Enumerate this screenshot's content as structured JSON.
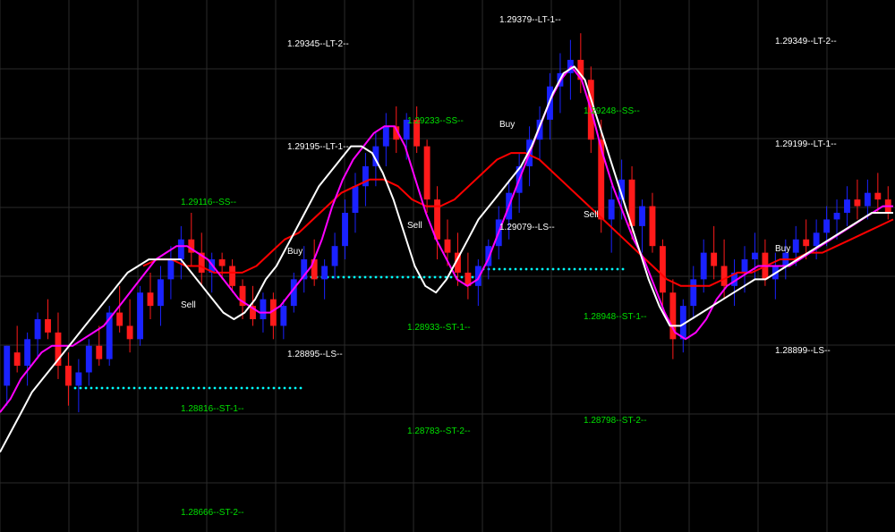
{
  "colors": {
    "background": "#000000",
    "grid": "#2a2a2a",
    "bull": "#1a22ff",
    "bear": "#ff1a1a",
    "doji": "#ffffff",
    "ma_fast": "#ff00ff",
    "ma_slow": "#ffffff",
    "ma_mid": "#ff0000",
    "level_long": "#ffffff",
    "level_short": "#00e000",
    "dots": "#00ffff"
  },
  "chart_data": {
    "type": "candlestick",
    "y_range": [
      1.2862,
      1.2942
    ],
    "grid": true,
    "candles": [
      [
        1.2884,
        1.289,
        1.2881,
        1.289
      ],
      [
        1.2889,
        1.2893,
        1.2886,
        1.2887
      ],
      [
        1.2887,
        1.2892,
        1.2884,
        1.2891
      ],
      [
        1.2891,
        1.2895,
        1.2888,
        1.2894
      ],
      [
        1.2894,
        1.2897,
        1.2891,
        1.2892
      ],
      [
        1.2892,
        1.2895,
        1.2885,
        1.2887
      ],
      [
        1.2887,
        1.2889,
        1.2881,
        1.2884
      ],
      [
        1.2884,
        1.2888,
        1.288,
        1.2886
      ],
      [
        1.2886,
        1.2891,
        1.2884,
        1.289
      ],
      [
        1.289,
        1.2893,
        1.2887,
        1.2888
      ],
      [
        1.2888,
        1.2896,
        1.2887,
        1.2895
      ],
      [
        1.2895,
        1.2899,
        1.2892,
        1.2893
      ],
      [
        1.2893,
        1.2897,
        1.2889,
        1.2891
      ],
      [
        1.2891,
        1.2899,
        1.289,
        1.2898
      ],
      [
        1.2898,
        1.2901,
        1.2894,
        1.2896
      ],
      [
        1.2896,
        1.2902,
        1.2893,
        1.29
      ],
      [
        1.29,
        1.2905,
        1.2897,
        1.2903
      ],
      [
        1.2903,
        1.2908,
        1.29,
        1.2906
      ],
      [
        1.2906,
        1.291,
        1.2902,
        1.2904
      ],
      [
        1.2904,
        1.2907,
        1.2899,
        1.2901
      ],
      [
        1.2901,
        1.2904,
        1.2898,
        1.2903
      ],
      [
        1.2903,
        1.2904,
        1.29,
        1.2902
      ],
      [
        1.2902,
        1.2903,
        1.2898,
        1.2899
      ],
      [
        1.2899,
        1.29,
        1.2894,
        1.2896
      ],
      [
        1.2896,
        1.2899,
        1.2893,
        1.2894
      ],
      [
        1.2894,
        1.2898,
        1.2892,
        1.2897
      ],
      [
        1.2897,
        1.2898,
        1.2891,
        1.2893
      ],
      [
        1.2893,
        1.2897,
        1.2891,
        1.2896
      ],
      [
        1.2896,
        1.2901,
        1.2895,
        1.29
      ],
      [
        1.29,
        1.2905,
        1.2898,
        1.2903
      ],
      [
        1.2903,
        1.2906,
        1.2899,
        1.29
      ],
      [
        1.29,
        1.2903,
        1.2897,
        1.2902
      ],
      [
        1.2902,
        1.2907,
        1.29,
        1.2905
      ],
      [
        1.2905,
        1.2912,
        1.2903,
        1.291
      ],
      [
        1.291,
        1.2916,
        1.2907,
        1.2914
      ],
      [
        1.2914,
        1.2919,
        1.2911,
        1.2917
      ],
      [
        1.2917,
        1.2922,
        1.2914,
        1.292
      ],
      [
        1.292,
        1.2925,
        1.2917,
        1.2923
      ],
      [
        1.2923,
        1.2926,
        1.2919,
        1.2921
      ],
      [
        1.2921,
        1.2925,
        1.2918,
        1.2924
      ],
      [
        1.2924,
        1.2926,
        1.2919,
        1.292
      ],
      [
        1.292,
        1.2921,
        1.291,
        1.2912
      ],
      [
        1.2912,
        1.2914,
        1.2903,
        1.2906
      ],
      [
        1.2906,
        1.2909,
        1.2902,
        1.2904
      ],
      [
        1.2904,
        1.2907,
        1.2899,
        1.2901
      ],
      [
        1.2901,
        1.2904,
        1.2897,
        1.2899
      ],
      [
        1.2899,
        1.2903,
        1.2896,
        1.2902
      ],
      [
        1.2902,
        1.2906,
        1.29,
        1.2905
      ],
      [
        1.2905,
        1.2911,
        1.2903,
        1.2909
      ],
      [
        1.2909,
        1.2915,
        1.2906,
        1.2913
      ],
      [
        1.2913,
        1.2919,
        1.291,
        1.2917
      ],
      [
        1.2917,
        1.2923,
        1.2914,
        1.2921
      ],
      [
        1.2921,
        1.2926,
        1.2918,
        1.2924
      ],
      [
        1.2924,
        1.2931,
        1.2921,
        1.2929
      ],
      [
        1.2929,
        1.2934,
        1.2925,
        1.2931
      ],
      [
        1.2931,
        1.2936,
        1.2927,
        1.2933
      ],
      [
        1.2933,
        1.2937,
        1.2928,
        1.293
      ],
      [
        1.293,
        1.2932,
        1.2919,
        1.2921
      ],
      [
        1.2921,
        1.2924,
        1.2907,
        1.2909
      ],
      [
        1.2909,
        1.2914,
        1.2904,
        1.2912
      ],
      [
        1.2912,
        1.2918,
        1.2909,
        1.2915
      ],
      [
        1.2915,
        1.2917,
        1.2906,
        1.2908
      ],
      [
        1.2908,
        1.2912,
        1.2904,
        1.2911
      ],
      [
        1.2911,
        1.2913,
        1.2904,
        1.2905
      ],
      [
        1.2905,
        1.2906,
        1.2896,
        1.2898
      ],
      [
        1.2898,
        1.29,
        1.2888,
        1.2891
      ],
      [
        1.2891,
        1.2897,
        1.2889,
        1.2896
      ],
      [
        1.2896,
        1.2902,
        1.2894,
        1.29
      ],
      [
        1.29,
        1.2906,
        1.2898,
        1.2904
      ],
      [
        1.2904,
        1.2908,
        1.29,
        1.2902
      ],
      [
        1.2902,
        1.2906,
        1.2897,
        1.2899
      ],
      [
        1.2899,
        1.2903,
        1.2896,
        1.2901
      ],
      [
        1.2901,
        1.2905,
        1.2898,
        1.2903
      ],
      [
        1.2903,
        1.2907,
        1.29,
        1.2904
      ],
      [
        1.2904,
        1.2906,
        1.2899,
        1.29
      ],
      [
        1.29,
        1.2904,
        1.2897,
        1.2902
      ],
      [
        1.2902,
        1.2906,
        1.29,
        1.2904
      ],
      [
        1.2904,
        1.2908,
        1.2902,
        1.2906
      ],
      [
        1.2906,
        1.2909,
        1.2903,
        1.2905
      ],
      [
        1.2905,
        1.2909,
        1.2903,
        1.2907
      ],
      [
        1.2907,
        1.2911,
        1.2905,
        1.2909
      ],
      [
        1.2909,
        1.2912,
        1.2906,
        1.291
      ],
      [
        1.291,
        1.2914,
        1.2908,
        1.2912
      ],
      [
        1.2912,
        1.2915,
        1.2909,
        1.2911
      ],
      [
        1.2911,
        1.2915,
        1.2909,
        1.2913
      ],
      [
        1.2913,
        1.2916,
        1.291,
        1.2912
      ],
      [
        1.2912,
        1.2914,
        1.2909,
        1.291
      ]
    ],
    "ma_fast": [
      1.288,
      1.2882,
      1.2885,
      1.2887,
      1.2889,
      1.289,
      1.289,
      1.289,
      1.2891,
      1.2892,
      1.2893,
      1.2895,
      1.2897,
      1.2899,
      1.2901,
      1.2903,
      1.2904,
      1.2905,
      1.2905,
      1.2904,
      1.2903,
      1.2901,
      1.2899,
      1.2897,
      1.2896,
      1.2895,
      1.2895,
      1.2896,
      1.2898,
      1.29,
      1.2902,
      1.2906,
      1.2911,
      1.2915,
      1.2918,
      1.292,
      1.2922,
      1.2923,
      1.2923,
      1.292,
      1.2915,
      1.291,
      1.2906,
      1.2903,
      1.29,
      1.2899,
      1.29,
      1.2903,
      1.2907,
      1.2911,
      1.2915,
      1.2919,
      1.2923,
      1.2927,
      1.293,
      1.2932,
      1.293,
      1.2925,
      1.2919,
      1.2914,
      1.291,
      1.2906,
      1.2903,
      1.2899,
      1.2895,
      1.2892,
      1.2891,
      1.2892,
      1.2894,
      1.2897,
      1.2899,
      1.29,
      1.2901,
      1.2902,
      1.2902,
      1.2902,
      1.2902,
      1.2903,
      1.2904,
      1.2905,
      1.2906,
      1.2907,
      1.2908,
      1.2909,
      1.291,
      1.2911,
      1.2911
    ],
    "ma_slow": [
      1.2874,
      1.2877,
      1.288,
      1.2883,
      1.2885,
      1.2887,
      1.2889,
      1.2891,
      1.2893,
      1.2895,
      1.2897,
      1.2899,
      1.2901,
      1.2902,
      1.2903,
      1.2903,
      1.2903,
      1.2903,
      1.2901,
      1.2899,
      1.2897,
      1.2895,
      1.2894,
      1.2895,
      1.2897,
      1.29,
      1.2902,
      1.2905,
      1.2908,
      1.2911,
      1.2914,
      1.2916,
      1.2918,
      1.292,
      1.292,
      1.2919,
      1.2916,
      1.2912,
      1.2907,
      1.2902,
      1.2899,
      1.2898,
      1.29,
      1.2903,
      1.2906,
      1.2909,
      1.2911,
      1.2913,
      1.2915,
      1.2917,
      1.292,
      1.2924,
      1.2928,
      1.2931,
      1.2932,
      1.293,
      1.2925,
      1.292,
      1.2915,
      1.291,
      1.2905,
      1.29,
      1.2896,
      1.2893,
      1.2893,
      1.2894,
      1.2895,
      1.2896,
      1.2897,
      1.2898,
      1.2899,
      1.29,
      1.29,
      1.2901,
      1.2902,
      1.2903,
      1.2904,
      1.2905,
      1.2906,
      1.2907,
      1.2908,
      1.2909,
      1.291,
      1.291,
      1.291
    ],
    "ma_mid": [
      1.2902,
      1.2903,
      1.2903,
      1.2902,
      1.2902,
      1.2901,
      1.2901,
      1.2901,
      1.2902,
      1.2904,
      1.2906,
      1.2907,
      1.2909,
      1.2911,
      1.2913,
      1.2914,
      1.2915,
      1.2915,
      1.2914,
      1.2912,
      1.2911,
      1.2911,
      1.2912,
      1.2914,
      1.2916,
      1.2918,
      1.2919,
      1.2919,
      1.2918,
      1.2916,
      1.2914,
      1.2912,
      1.291,
      1.2908,
      1.2906,
      1.2904,
      1.2902,
      1.29,
      1.2899,
      1.2899,
      1.2899,
      1.29,
      1.2901,
      1.2901,
      1.2902,
      1.2903,
      1.2903,
      1.2904,
      1.2904,
      1.2905,
      1.2906,
      1.2907,
      1.2908,
      1.2909
    ]
  },
  "levels_col1": {
    "lt2": "1.29345--LT-2--",
    "lt1": "1.29195--LT-1--",
    "ss": "1.29116--SS--",
    "ls": "1.28895--LS--",
    "st1": "1.28816--ST-1--",
    "st2": "1.28666--ST-2--"
  },
  "levels_col2": {
    "lt1": "1.29379--LT-1--",
    "ss": "1.29233--SS--",
    "ls": "1.29079--LS--",
    "st1": "1.28933--ST-1--",
    "st2": "1.28783--ST-2--"
  },
  "levels_col3": {
    "ss": "1.29248--SS--",
    "st1": "1.28948--ST-1--",
    "st2": "1.28798--ST-2--"
  },
  "levels_col4": {
    "lt2": "1.29349--LT-2--",
    "lt1": "1.29199--LT-1--",
    "ls": "1.28899--LS--"
  },
  "signals": {
    "sell": "Sell",
    "buy": "Buy"
  }
}
